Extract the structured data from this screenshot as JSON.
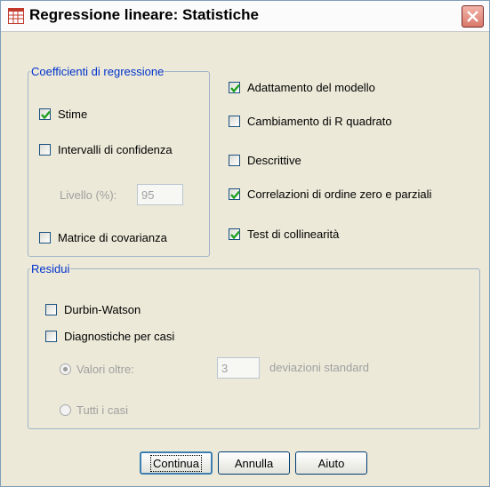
{
  "window": {
    "title": "Regressione lineare: Statistiche"
  },
  "coefficienti": {
    "legend": "Coefficienti di regressione",
    "stime": {
      "label": "Stime",
      "checked": true
    },
    "intervalli": {
      "label": "Intervalli di confidenza",
      "checked": false
    },
    "livello": {
      "label": "Livello (%):",
      "value": "95"
    },
    "matrice": {
      "label": "Matrice di covarianza",
      "checked": false
    }
  },
  "options": {
    "adattamento": {
      "label": "Adattamento del modello",
      "checked": true
    },
    "cambiamento": {
      "label": "Cambiamento di R quadrato",
      "checked": false
    },
    "descrittive": {
      "label": "Descrittive",
      "checked": false
    },
    "correlazioni": {
      "label": "Correlazioni di ordine zero e parziali",
      "checked": true
    },
    "collinearita": {
      "label": "Test di collinearità",
      "checked": true
    }
  },
  "residui": {
    "legend": "Residui",
    "durbin": {
      "label": "Durbin-Watson",
      "checked": false
    },
    "diagnostiche": {
      "label": "Diagnostiche per casi",
      "checked": false
    },
    "valori_oltre": {
      "label": "Valori oltre:",
      "selected": true
    },
    "soglia": "3",
    "deviazioni": "deviazioni standard",
    "tutti": {
      "label": "Tutti i casi",
      "selected": false
    }
  },
  "buttons": {
    "continua": "Continua",
    "annulla": "Annulla",
    "aiuto": "Aiuto"
  },
  "icons": {
    "app": "spss-grid-icon",
    "close": "close-icon",
    "check": "checkmark-icon"
  },
  "colors": {
    "legend": "#0033cc",
    "check": "#21a121",
    "close": "#d9786a"
  }
}
